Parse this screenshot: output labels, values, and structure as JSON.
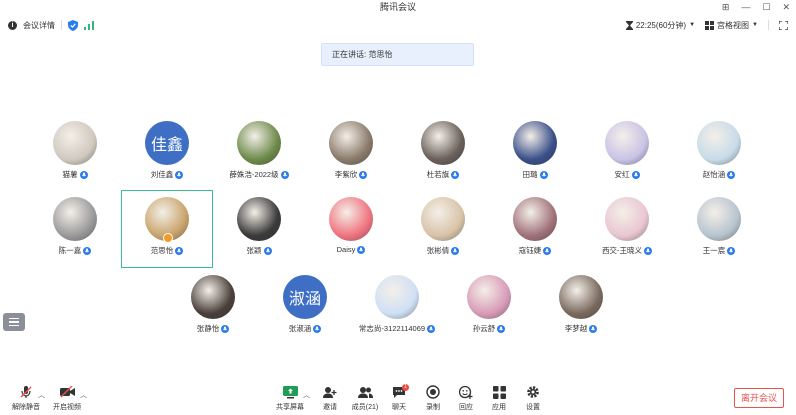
{
  "window": {
    "title": "腾讯会议"
  },
  "toolbar": {
    "meeting_details": "会议详情",
    "timer": "22:25(60分钟)",
    "view_mode": "宫格视图"
  },
  "speaking": {
    "text": "正在讲话: 范思怡"
  },
  "participants": [
    {
      "name": "猫薯",
      "avatar": "#cfc9bf"
    },
    {
      "name": "刘佳鑫",
      "avatar_text": "佳鑫"
    },
    {
      "name": "薛姝浩-2022级",
      "avatar": "#6c8a4a"
    },
    {
      "name": "李紫欣",
      "avatar": "#8a7a6a"
    },
    {
      "name": "杜若旗",
      "avatar": "#6a5f5a"
    },
    {
      "name": "田璐",
      "avatar": "#3a4f8a"
    },
    {
      "name": "安红",
      "avatar": "#c9c3e6"
    },
    {
      "name": "赵怡涵",
      "avatar": "#c7dbe8"
    },
    {
      "name": "陈一嘉",
      "avatar": "#9a9a9a"
    },
    {
      "name": "范思怡",
      "avatar": "#c9a56d"
    },
    {
      "name": "张颖",
      "avatar": "#3a3a3a"
    },
    {
      "name": "Daisy",
      "avatar": "#f07480"
    },
    {
      "name": "张彬倩",
      "avatar": "#d8c3a8"
    },
    {
      "name": "寇钰婕",
      "avatar": "#a0727a"
    },
    {
      "name": "西交-王晓义",
      "avatar": "#e9c6d2"
    },
    {
      "name": "王一宸",
      "avatar": "#b7c4cf"
    },
    {
      "name": "张静怡",
      "avatar": "#4a3f3a"
    },
    {
      "name": "张淑涵",
      "avatar_text": "淑涵"
    },
    {
      "name": "常志尚-3122114069",
      "avatar": "#cfe0f5"
    },
    {
      "name": "孙云舒",
      "avatar": "#d89bb7"
    },
    {
      "name": "李梦越",
      "avatar": "#7a6a5e"
    }
  ],
  "bottombar": {
    "unmute": "解除静音",
    "start_video": "开启视频",
    "share_screen": "共享屏幕",
    "invite": "邀请",
    "members": "成员(21)",
    "chat": "聊天",
    "record": "录制",
    "reactions": "回应",
    "apps": "应用",
    "settings": "设置",
    "chat_badge": "1",
    "leave": "离开会议"
  }
}
